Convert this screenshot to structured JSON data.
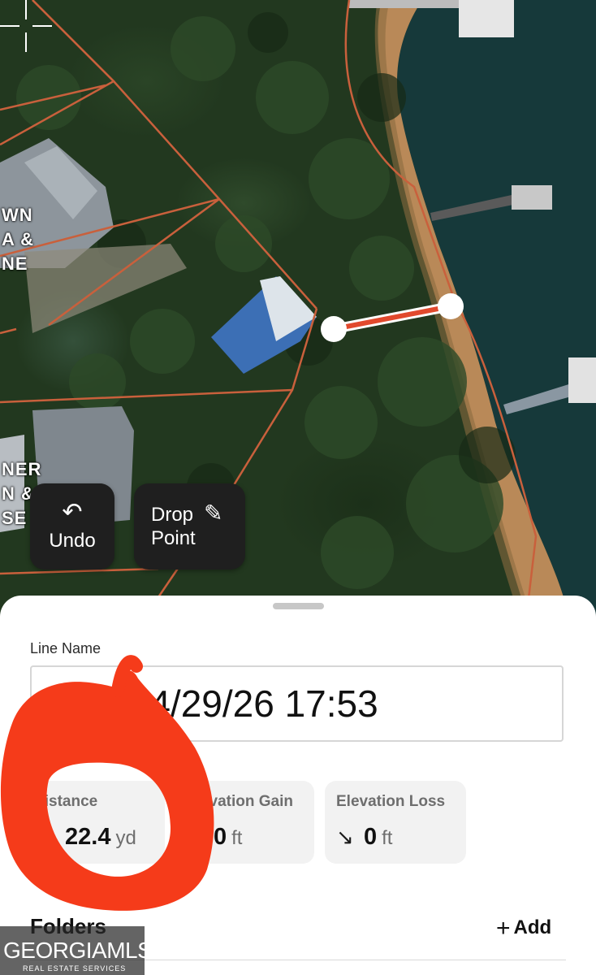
{
  "map": {
    "parcel_labels": [
      {
        "text": "WN\nA &\nNE"
      },
      {
        "text": "NER\nN &\nSE"
      }
    ],
    "undo_icon": "undo-arrow-icon",
    "undo_label": "Undo",
    "drop_label": "Drop\nPoint",
    "drop_icon": "pencil-icon",
    "line_color": "#e1492d"
  },
  "sheet": {
    "line_name_label": "Line Name",
    "line_name_value": "Line 04/29/26 17:53",
    "stats": [
      {
        "title": "Distance",
        "icon": "horizontal-arrows-icon",
        "arrow": "↔",
        "value": "22.4",
        "unit": "yd"
      },
      {
        "title": "Elevation Gain",
        "icon": "up-right-arrow-icon",
        "arrow": "↗",
        "value": "0",
        "unit": "ft"
      },
      {
        "title": "Elevation Loss",
        "icon": "down-right-arrow-icon",
        "arrow": "↘",
        "value": "0",
        "unit": "ft"
      }
    ],
    "folders_label": "Folders",
    "add_label": "Add"
  },
  "watermark": {
    "main": "GEORGIAMLS",
    "sub": "REAL ESTATE SERVICES"
  }
}
